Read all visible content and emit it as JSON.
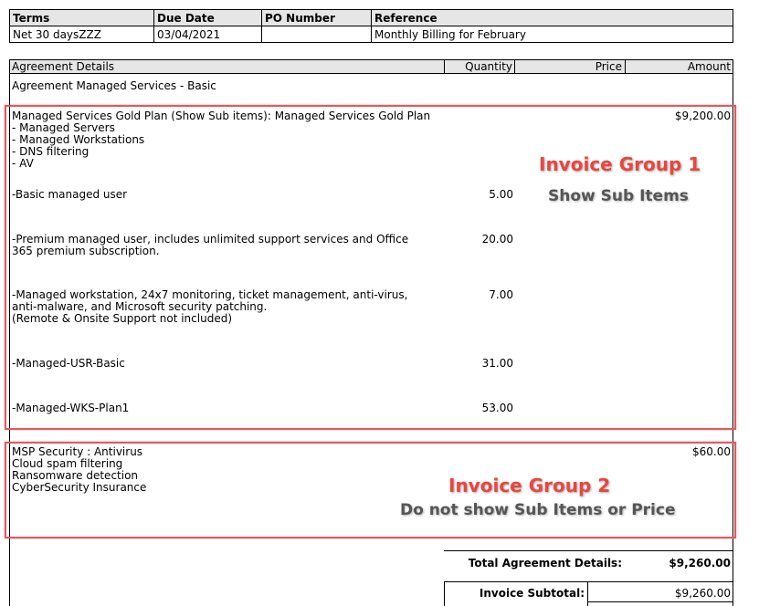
{
  "terms_table": {
    "headers": [
      "Terms",
      "Due Date",
      "PO Number",
      "Reference"
    ],
    "values": [
      "Net 30 daysZZZ",
      "03/04/2021",
      "",
      "Monthly Billing for February"
    ]
  },
  "agreement_header": {
    "details": "Agreement Details",
    "quantity": "Quantity",
    "price": "Price",
    "amount": "Amount"
  },
  "agreement_name": "Agreement Managed Services - Basic",
  "group1": {
    "title": "Managed Services Gold Plan (Show Sub items): Managed Services Gold Plan",
    "amount": "$9,200.00",
    "sub_list": [
      "- Managed Servers",
      "- Managed Workstations",
      "- DNS filtering",
      "- AV"
    ],
    "items": [
      {
        "lines": [
          "-Basic managed user"
        ],
        "qty": "5.00"
      },
      {
        "lines": [
          "-Premium managed user, includes unlimited support services and Office",
          "365 premium subscription."
        ],
        "qty": "20.00"
      },
      {
        "lines": [
          "-Managed workstation, 24x7 monitoring, ticket management, anti-virus,",
          "anti-malware, and Microsoft security patching.",
          "(Remote & Onsite Support not included)"
        ],
        "qty": "7.00"
      },
      {
        "lines": [
          "-Managed-USR-Basic"
        ],
        "qty": "31.00"
      },
      {
        "lines": [
          "-Managed-WKS-Plan1"
        ],
        "qty": "53.00"
      }
    ]
  },
  "group2": {
    "title": "MSP Security : Antivirus",
    "amount": "$60.00",
    "sub_list": [
      "Cloud spam filtering",
      "Ransomware detection",
      "CyberSecurity Insurance"
    ]
  },
  "annotations": {
    "group1_title": "Invoice Group 1",
    "group1_sub": "Show Sub Items",
    "group2_title": "Invoice Group 2",
    "group2_sub": "Do not show Sub Items or Price",
    "box_color": "#e05a5f",
    "title_color": "#e8463f"
  },
  "totals": {
    "agreement_label": "Total Agreement Details:",
    "agreement_value": "$9,260.00",
    "subtotal_label": "Invoice Subtotal:",
    "subtotal_value": "$9,260.00"
  }
}
